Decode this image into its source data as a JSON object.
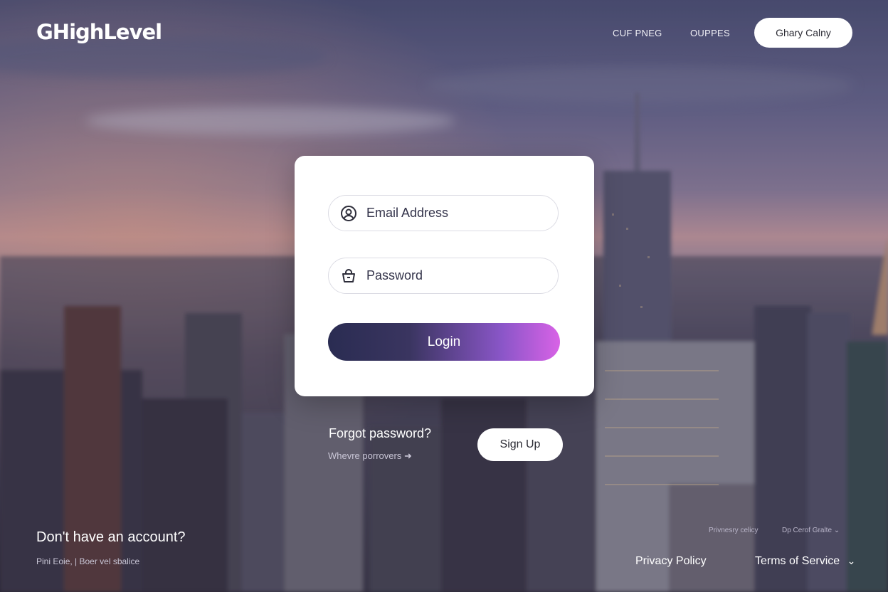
{
  "brand": {
    "logo": "GHighLevel"
  },
  "nav": {
    "links": [
      "CUF PNEG",
      "OUPPES"
    ],
    "button": "Ghary Calny"
  },
  "login": {
    "email_placeholder": "Email Address",
    "password_placeholder": "Password",
    "login_label": "Login"
  },
  "below_card": {
    "forgot_password": "Forgot password?",
    "sub_link": "Whevre porrovers",
    "signup_label": "Sign Up"
  },
  "footer": {
    "no_account": "Don't have an account?",
    "small_note": "Pini Eoie, | Boer vel sbalice",
    "small_links": [
      "Privnesry celicy",
      "Dp Cerof Gralte"
    ],
    "privacy": "Privacy Policy",
    "terms": "Terms of Service"
  },
  "colors": {
    "gradient_start": "#2a2c52",
    "gradient_end": "#d862e6"
  },
  "icons": {
    "email": "user-circle-icon",
    "password": "lock-basket-icon",
    "arrow": "arrow-right-icon",
    "terms": "chevron-down-icon"
  }
}
